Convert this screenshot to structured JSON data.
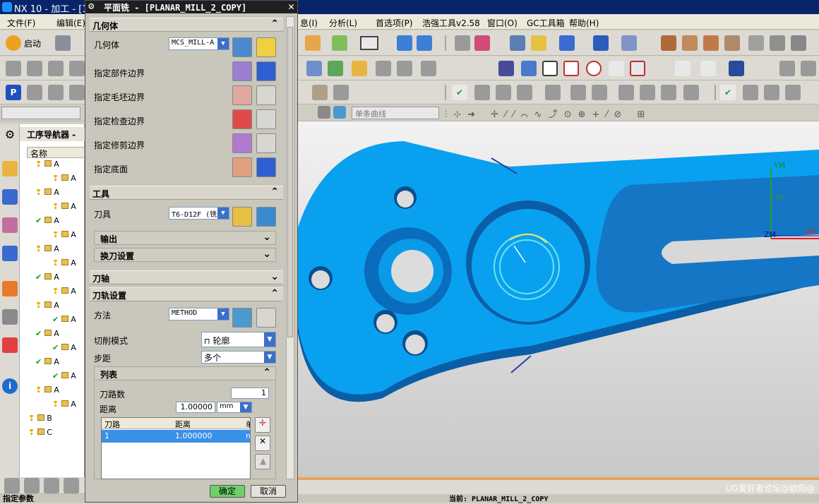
{
  "app": {
    "title": "NX 10 - 加工 - [1",
    "menu": [
      "文件(F)",
      "编辑(E)",
      "息(I)",
      "分析(L)",
      "首选项(P)",
      "浩强工具v2.58",
      "窗口(O)",
      "GC工具箱",
      "帮助(H)"
    ],
    "launch_label": "启动"
  },
  "dialog": {
    "title": "平面铣 - [PLANAR_MILL_2_COPY]",
    "geometry": {
      "header": "几何体",
      "geometry_label": "几何体",
      "geometry_value": "MCS_MILL-A",
      "rows": [
        "指定部件边界",
        "指定毛坯边界",
        "指定检查边界",
        "指定修剪边界",
        "指定底面"
      ]
    },
    "tool": {
      "header": "工具",
      "tool_label": "刀具",
      "tool_value": "T6-D12F (铣",
      "output_label": "输出",
      "toolchange_label": "换刀设置"
    },
    "axis": {
      "header": "刀轴"
    },
    "path": {
      "header": "刀轨设置",
      "method_label": "方法",
      "method_value": "METHOD",
      "cut_mode_label": "切削模式",
      "cut_mode_value": "轮廓",
      "stepover_label": "步距",
      "stepover_value": "多个",
      "list": {
        "header": "列表",
        "path_count_label": "刀路数",
        "path_count_value": "1",
        "distance_label": "距离",
        "distance_value": "1.00000",
        "unit": "mm",
        "columns": [
          "刀路",
          "距离",
          "单"
        ],
        "rows": [
          [
            "1",
            "1.000000",
            "mm"
          ]
        ]
      }
    },
    "ok_label": "确定",
    "cancel_label": "取消"
  },
  "navigator": {
    "title": "工序导航器 -",
    "column_name": "名称",
    "items": [
      "A",
      "A",
      "A",
      "A",
      "A",
      "A",
      "A",
      "A",
      "A",
      "A",
      "A",
      "A",
      "A",
      "A",
      "A",
      "A",
      "A",
      "A",
      "B",
      "C"
    ]
  },
  "toolbar": {
    "curve_filter": "单条曲线"
  },
  "viewport": {
    "axis_labels": [
      "YM",
      "YC",
      "ZM",
      "XC"
    ],
    "watermark": "UG爱好者论坛@欧阳@"
  },
  "status": {
    "left": "指定参数",
    "right": "当前: PLANAR_MILL_2_COPY"
  },
  "colors": {
    "part_blue": "#0aa0f0",
    "part_dark": "#0a5ea8",
    "title_bar": "#1f1f1f",
    "ok_green": "#6cd06c"
  }
}
